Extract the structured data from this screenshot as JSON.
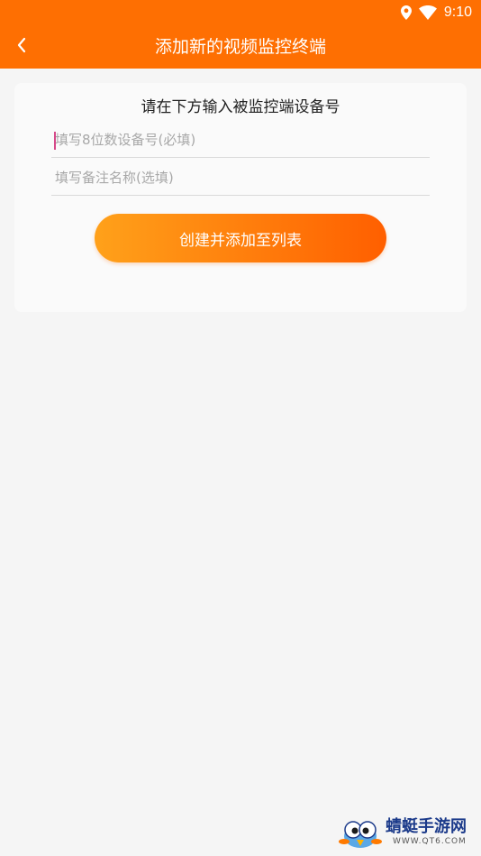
{
  "colors": {
    "header": "#fe6f02",
    "background": "#f5f5f5",
    "card": "#fafafa",
    "button_start": "#ffa11a",
    "button_end": "#ff5f00",
    "cursor": "#d64a8a"
  },
  "status_bar": {
    "time": "9:10",
    "icons": [
      "location-icon",
      "wifi-icon"
    ]
  },
  "header": {
    "title": "添加新的视频监控终端",
    "back_icon": "chevron-left-icon"
  },
  "form": {
    "prompt": "请在下方输入被监控端设备号",
    "device_number": {
      "value": "",
      "placeholder": "填写8位数设备号(必填)"
    },
    "remark_name": {
      "value": "",
      "placeholder": "填写备注名称(选填)"
    },
    "submit_label": "创建并添加至列表"
  },
  "watermark": {
    "name": "蜻蜓手游网",
    "url": "WWW.QT6.COM"
  }
}
